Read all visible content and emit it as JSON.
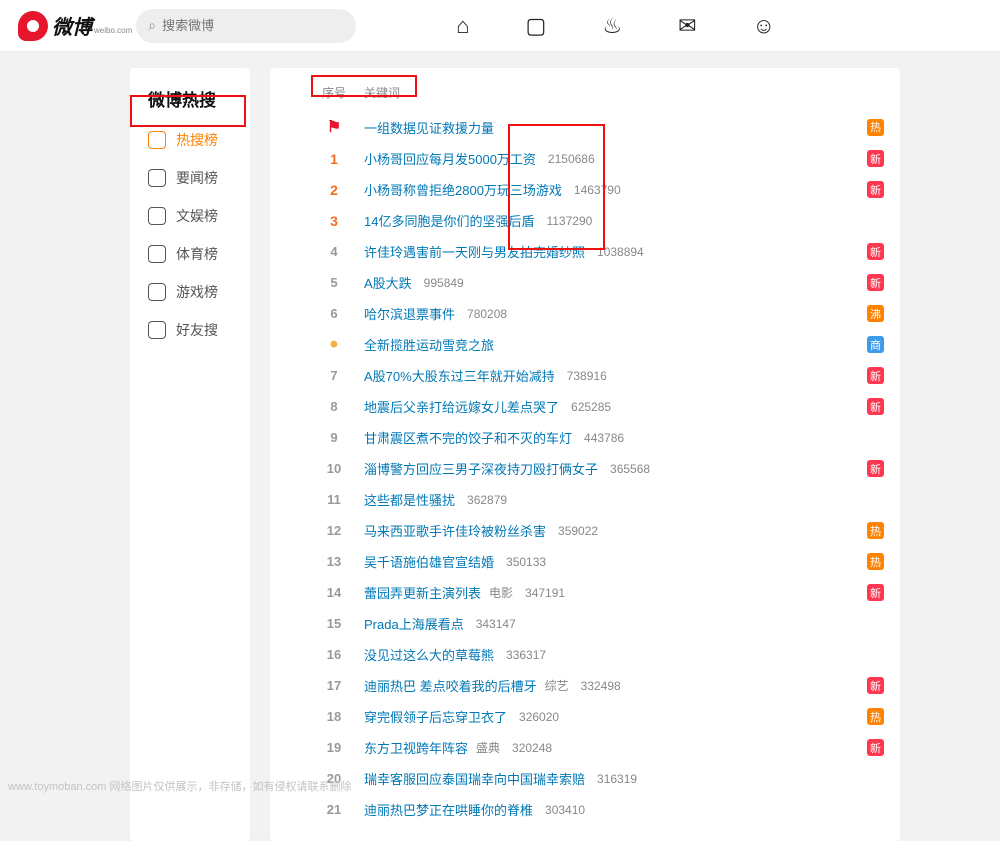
{
  "brand": {
    "text": "微博",
    "sub": "weibo.com"
  },
  "search": {
    "placeholder": "搜索微博"
  },
  "side": {
    "title": "微博热搜",
    "items": [
      "热搜榜",
      "要闻榜",
      "文娱榜",
      "体育榜",
      "游戏榜",
      "好友搜"
    ]
  },
  "thead": {
    "rank": "序号",
    "kw": "关键词"
  },
  "badges": {
    "hot": "热",
    "new": "新",
    "boil": "沸",
    "biz": "商"
  },
  "rows": [
    {
      "rank": "top",
      "title": "一组数据见证救援力量",
      "count": "",
      "badge": "hot"
    },
    {
      "rank": "1",
      "title": "小杨哥回应每月发5000万工资",
      "count": "2150686",
      "badge": "new"
    },
    {
      "rank": "2",
      "title": "小杨哥称曾拒绝2800万玩三场游戏",
      "count": "1463790",
      "badge": "new"
    },
    {
      "rank": "3",
      "title": "14亿多同胞是你们的坚强后盾",
      "count": "1137290",
      "badge": ""
    },
    {
      "rank": "4",
      "title": "许佳玲遇害前一天刚与男友拍完婚纱照",
      "count": "1038894",
      "badge": "new"
    },
    {
      "rank": "5",
      "title": "A股大跌",
      "count": "995849",
      "badge": "new"
    },
    {
      "rank": "6",
      "title": "哈尔滨退票事件",
      "count": "780208",
      "badge": "boil"
    },
    {
      "rank": "dot",
      "title": "全新揽胜运动雪竞之旅",
      "count": "",
      "badge": "biz"
    },
    {
      "rank": "7",
      "title": "A股70%大股东过三年就开始减持",
      "count": "738916",
      "badge": "new"
    },
    {
      "rank": "8",
      "title": "地震后父亲打给远嫁女儿差点哭了",
      "count": "625285",
      "badge": "new"
    },
    {
      "rank": "9",
      "title": "甘肃震区煮不完的饺子和不灭的车灯",
      "count": "443786",
      "badge": ""
    },
    {
      "rank": "10",
      "title": "淄博警方回应三男子深夜持刀殴打俩女子",
      "count": "365568",
      "badge": "new"
    },
    {
      "rank": "11",
      "title": "这些都是性骚扰",
      "count": "362879",
      "badge": ""
    },
    {
      "rank": "12",
      "title": "马来西亚歌手许佳玲被粉丝杀害",
      "count": "359022",
      "badge": "hot"
    },
    {
      "rank": "13",
      "title": "吴千语施伯雄官宣结婚",
      "count": "350133",
      "badge": "hot"
    },
    {
      "rank": "14",
      "title": "蕾园弄更新主演列表",
      "cat": "电影",
      "count": "347191",
      "badge": "new"
    },
    {
      "rank": "15",
      "title": "Prada上海展看点",
      "count": "343147",
      "badge": ""
    },
    {
      "rank": "16",
      "title": "没见过这么大的草莓熊",
      "count": "336317",
      "badge": ""
    },
    {
      "rank": "17",
      "title": "迪丽热巴 差点咬着我的后槽牙",
      "cat": "综艺",
      "count": "332498",
      "badge": "new"
    },
    {
      "rank": "18",
      "title": "穿完假领子后忘穿卫衣了",
      "count": "326020",
      "badge": "hot"
    },
    {
      "rank": "19",
      "title": "东方卫视跨年阵容",
      "cat": "盛典",
      "count": "320248",
      "badge": "new"
    },
    {
      "rank": "20",
      "title": "瑞幸客服回应泰国瑞幸向中国瑞幸索赔",
      "count": "316319",
      "badge": ""
    },
    {
      "rank": "21",
      "title": "迪丽热巴梦正在哄睡你的脊椎",
      "count": "303410",
      "badge": ""
    }
  ],
  "footer": "www.toymoban.com  网络图片仅供展示，非存储，如有侵权请联系删除"
}
